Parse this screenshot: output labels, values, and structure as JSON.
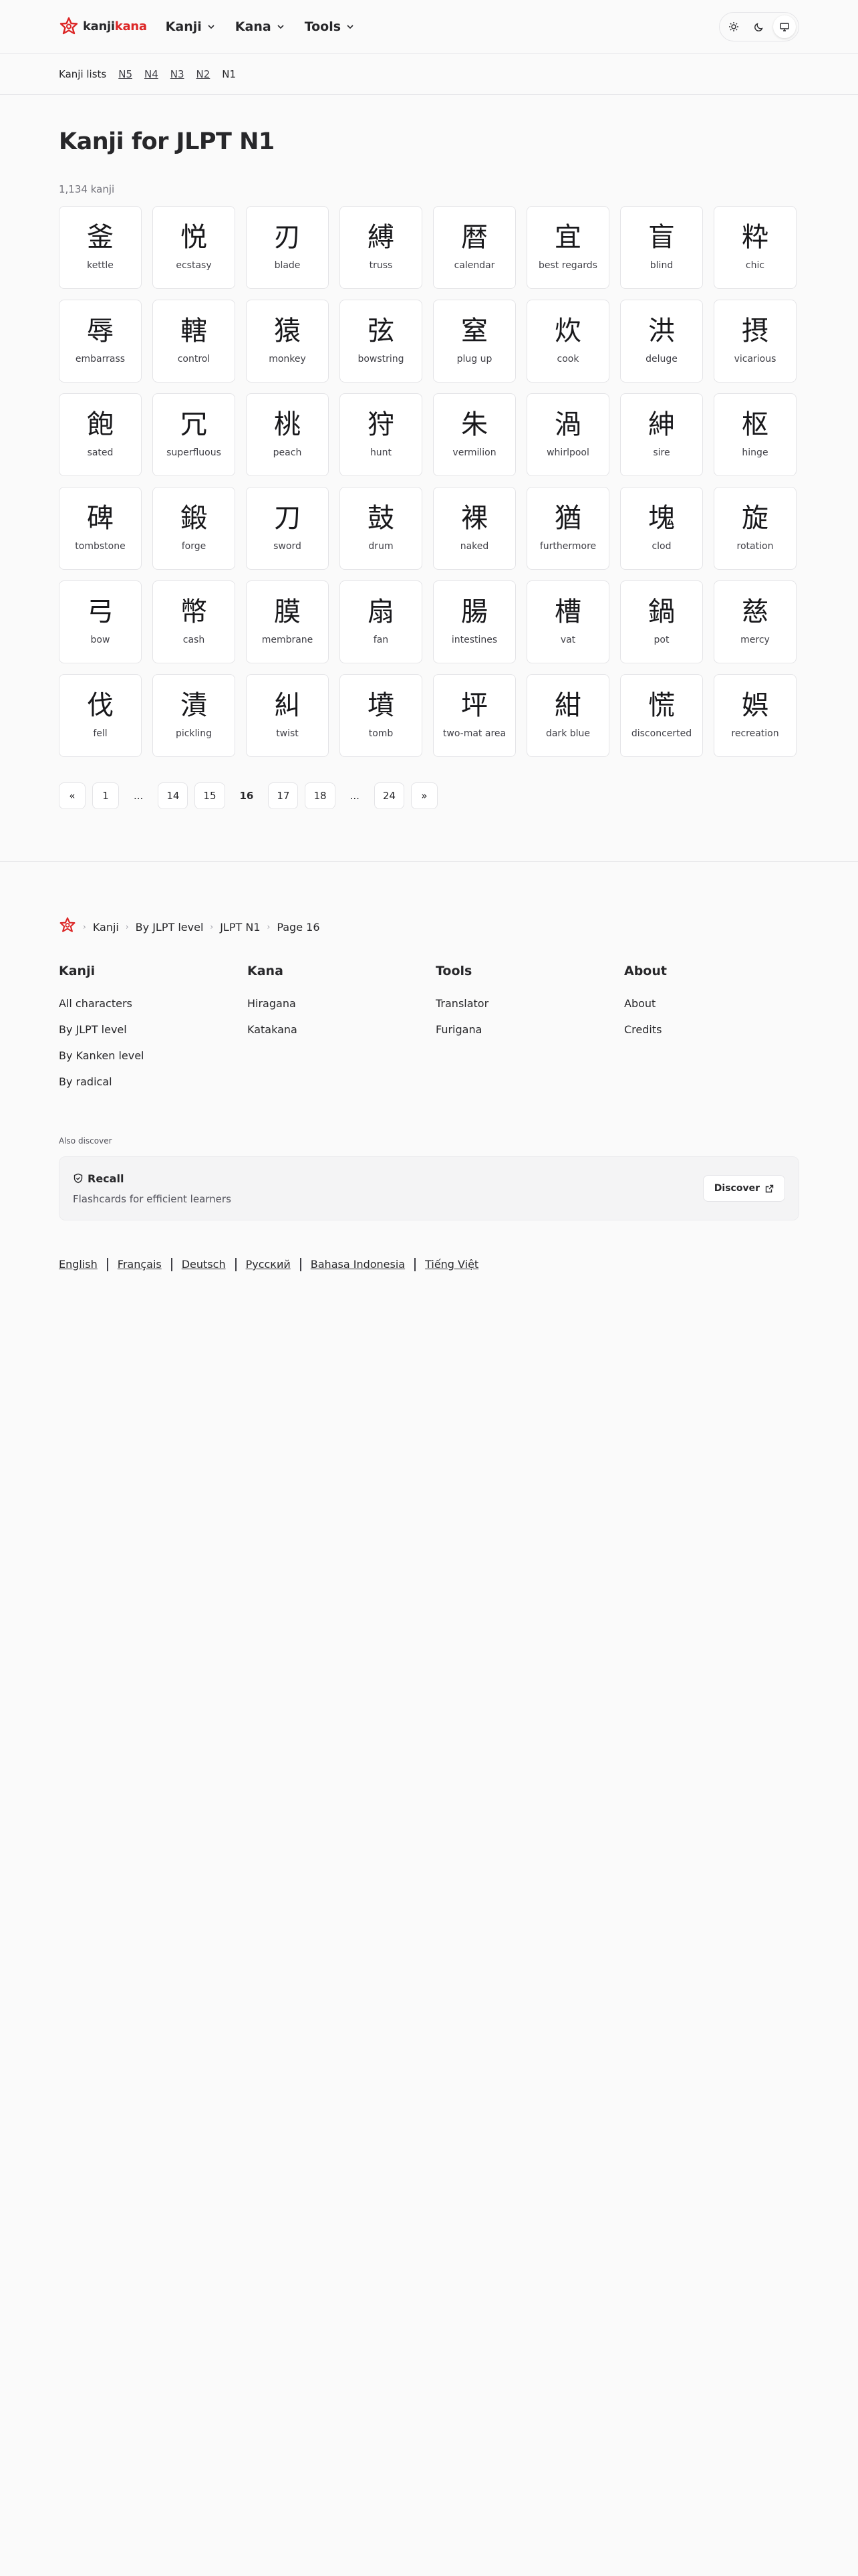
{
  "brand": {
    "part1": "kanji",
    "part2": "kana"
  },
  "nav": {
    "kanji": "Kanji",
    "kana": "Kana",
    "tools": "Tools"
  },
  "subnav": {
    "label": "Kanji lists",
    "levels": [
      "N5",
      "N4",
      "N3",
      "N2"
    ],
    "current": "N1"
  },
  "page": {
    "title": "Kanji for JLPT N1",
    "count": "1,134 kanji"
  },
  "kanji": [
    {
      "char": "釜",
      "meaning": "kettle"
    },
    {
      "char": "悦",
      "meaning": "ecstasy"
    },
    {
      "char": "刃",
      "meaning": "blade"
    },
    {
      "char": "縛",
      "meaning": "truss"
    },
    {
      "char": "暦",
      "meaning": "calendar"
    },
    {
      "char": "宜",
      "meaning": "best regards"
    },
    {
      "char": "盲",
      "meaning": "blind"
    },
    {
      "char": "粋",
      "meaning": "chic"
    },
    {
      "char": "辱",
      "meaning": "embarrass"
    },
    {
      "char": "轄",
      "meaning": "control"
    },
    {
      "char": "猿",
      "meaning": "monkey"
    },
    {
      "char": "弦",
      "meaning": "bowstring"
    },
    {
      "char": "窒",
      "meaning": "plug up"
    },
    {
      "char": "炊",
      "meaning": "cook"
    },
    {
      "char": "洪",
      "meaning": "deluge"
    },
    {
      "char": "摂",
      "meaning": "vicarious"
    },
    {
      "char": "飽",
      "meaning": "sated"
    },
    {
      "char": "冗",
      "meaning": "superfluous"
    },
    {
      "char": "桃",
      "meaning": "peach"
    },
    {
      "char": "狩",
      "meaning": "hunt"
    },
    {
      "char": "朱",
      "meaning": "vermilion"
    },
    {
      "char": "渦",
      "meaning": "whirlpool"
    },
    {
      "char": "紳",
      "meaning": "sire"
    },
    {
      "char": "枢",
      "meaning": "hinge"
    },
    {
      "char": "碑",
      "meaning": "tombstone"
    },
    {
      "char": "鍛",
      "meaning": "forge"
    },
    {
      "char": "刀",
      "meaning": "sword"
    },
    {
      "char": "鼓",
      "meaning": "drum"
    },
    {
      "char": "裸",
      "meaning": "naked"
    },
    {
      "char": "猶",
      "meaning": "furthermore"
    },
    {
      "char": "塊",
      "meaning": "clod"
    },
    {
      "char": "旋",
      "meaning": "rotation"
    },
    {
      "char": "弓",
      "meaning": "bow"
    },
    {
      "char": "幣",
      "meaning": "cash"
    },
    {
      "char": "膜",
      "meaning": "membrane"
    },
    {
      "char": "扇",
      "meaning": "fan"
    },
    {
      "char": "腸",
      "meaning": "intestines"
    },
    {
      "char": "槽",
      "meaning": "vat"
    },
    {
      "char": "鍋",
      "meaning": "pot"
    },
    {
      "char": "慈",
      "meaning": "mercy"
    },
    {
      "char": "伐",
      "meaning": "fell"
    },
    {
      "char": "漬",
      "meaning": "pickling"
    },
    {
      "char": "糾",
      "meaning": "twist"
    },
    {
      "char": "墳",
      "meaning": "tomb"
    },
    {
      "char": "坪",
      "meaning": "two-mat area"
    },
    {
      "char": "紺",
      "meaning": "dark blue"
    },
    {
      "char": "慌",
      "meaning": "disconcerted"
    },
    {
      "char": "娯",
      "meaning": "recreation"
    }
  ],
  "pagination": {
    "prev": "«",
    "first": "1",
    "ellipsis": "...",
    "p14": "14",
    "p15": "15",
    "current": "16",
    "p17": "17",
    "p18": "18",
    "last": "24",
    "next": "»"
  },
  "breadcrumb": {
    "kanji": "Kanji",
    "by_level": "By JLPT level",
    "level": "JLPT N1",
    "page": "Page 16"
  },
  "footer": {
    "columns": [
      {
        "title": "Kanji",
        "links": [
          "All characters",
          "By JLPT level",
          "By Kanken level",
          "By radical"
        ]
      },
      {
        "title": "Kana",
        "links": [
          "Hiragana",
          "Katakana"
        ]
      },
      {
        "title": "Tools",
        "links": [
          "Translator",
          "Furigana"
        ]
      },
      {
        "title": "About",
        "links": [
          "About",
          "Credits"
        ]
      }
    ],
    "also_discover": "Also discover",
    "promo": {
      "title": "Recall",
      "description": "Flashcards for efficient learners",
      "button": "Discover"
    },
    "languages": [
      "English",
      "Français",
      "Deutsch",
      "Русский",
      "Bahasa Indonesia",
      "Tiếng Việt"
    ]
  },
  "colors": {
    "accent": "#dc2626",
    "text": "#27272a",
    "border": "#e4e4e7",
    "background": "#fafafa"
  }
}
